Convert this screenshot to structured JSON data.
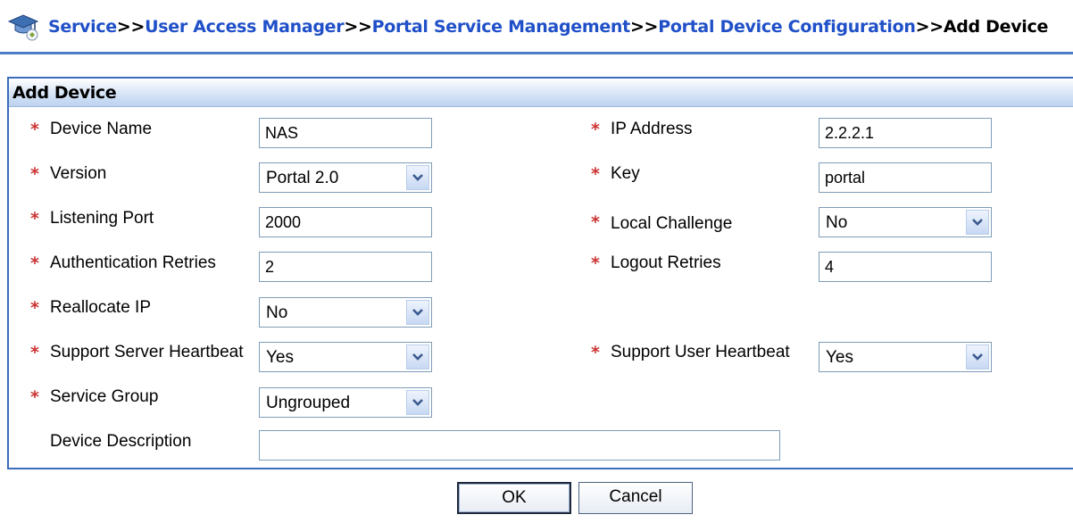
{
  "breadcrumb": {
    "items": [
      {
        "label": "Service"
      },
      {
        "label": "User Access Manager"
      },
      {
        "label": "Portal Service Management"
      },
      {
        "label": "Portal Device Configuration"
      }
    ],
    "separator": ">>",
    "current": "Add Device"
  },
  "panel": {
    "title": "Add Device"
  },
  "form": {
    "required_marker": "*",
    "device_name": {
      "label": "Device Name",
      "value": "NAS"
    },
    "ip_address": {
      "label": "IP Address",
      "value": "2.2.2.1"
    },
    "version": {
      "label": "Version",
      "value": "Portal 2.0"
    },
    "key": {
      "label": "Key",
      "value": "portal"
    },
    "listening_port": {
      "label": "Listening Port",
      "value": "2000"
    },
    "local_challenge": {
      "label": "Local Challenge",
      "value": "No"
    },
    "authentication_retries": {
      "label": "Authentication Retries",
      "value": "2"
    },
    "logout_retries": {
      "label": "Logout Retries",
      "value": "4"
    },
    "reallocate_ip": {
      "label": "Reallocate IP",
      "value": "No"
    },
    "support_server_heartbeat": {
      "label": "Support Server Heartbeat",
      "value": "Yes"
    },
    "support_user_heartbeat": {
      "label": "Support User Heartbeat",
      "value": "Yes"
    },
    "service_group": {
      "label": "Service Group",
      "value": "Ungrouped"
    },
    "device_description": {
      "label": "Device Description",
      "value": ""
    }
  },
  "buttons": {
    "ok": "OK",
    "cancel": "Cancel"
  },
  "icons": {
    "breadcrumb": "service-hat-icon",
    "dropdown": "chevron-down-icon"
  },
  "colors": {
    "link": "#2050c8",
    "required": "#cc3333",
    "panel_border": "#3c6cbc"
  }
}
